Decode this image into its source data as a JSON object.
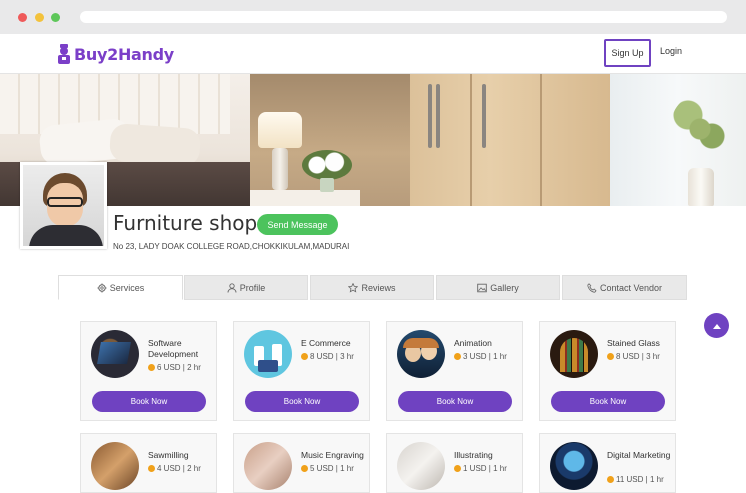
{
  "header": {
    "logo_text": "Buy2Handy",
    "signup_label": "Sign Up",
    "login_label": "Login"
  },
  "profile": {
    "shop_name": "Furniture shop",
    "send_message_label": "Send Message",
    "address": "No 23, LADY DOAK COLLEGE ROAD,CHOKKIKULAM,MADURAI"
  },
  "tabs": [
    {
      "label": "Services",
      "icon": "gear-icon",
      "active": true
    },
    {
      "label": "Profile",
      "icon": "user-icon",
      "active": false
    },
    {
      "label": "Reviews",
      "icon": "star-icon",
      "active": false
    },
    {
      "label": "Gallery",
      "icon": "image-icon",
      "active": false
    },
    {
      "label": "Contact Vendor",
      "icon": "phone-icon",
      "active": false
    }
  ],
  "services": [
    {
      "title": "Software Development",
      "price": "6 USD | 2 hr",
      "book_label": "Book Now"
    },
    {
      "title": "E Commerce",
      "price": "8 USD | 3 hr",
      "book_label": "Book Now"
    },
    {
      "title": "Animation",
      "price": "3 USD | 1 hr",
      "book_label": "Book Now"
    },
    {
      "title": "Stained Glass",
      "price": "8 USD | 3 hr",
      "book_label": "Book Now"
    },
    {
      "title": "Sawmilling",
      "price": "4 USD | 2 hr"
    },
    {
      "title": "Music Engraving",
      "price": "5 USD | 1 hr"
    },
    {
      "title": "Illustrating",
      "price": "1 USD | 1 hr"
    },
    {
      "title": "Digital Marketing",
      "price": "11 USD | 1 hr"
    }
  ],
  "colors": {
    "brand": "#6f42c1",
    "success": "#4cc35d",
    "coin": "#f0a11a"
  }
}
